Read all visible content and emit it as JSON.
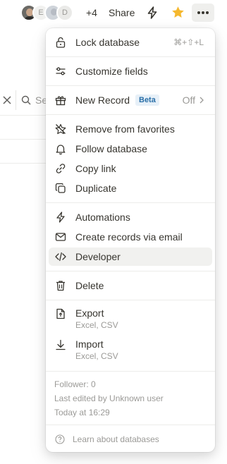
{
  "topbar": {
    "avatars": [
      {
        "letter": ""
      },
      {
        "letter": "E"
      },
      {
        "letter": ""
      },
      {
        "letter": "D"
      }
    ],
    "more_count": "+4",
    "share_label": "Share"
  },
  "background": {
    "search_text": "Se"
  },
  "menu": {
    "lock": {
      "label": "Lock database",
      "shortcut": "⌘+⇧+L"
    },
    "customize": {
      "label": "Customize fields"
    },
    "new_record": {
      "label": "New Record",
      "badge": "Beta",
      "value": "Off"
    },
    "remove_fav": {
      "label": "Remove from favorites"
    },
    "follow": {
      "label": "Follow database"
    },
    "copy_link": {
      "label": "Copy link"
    },
    "duplicate": {
      "label": "Duplicate"
    },
    "automations": {
      "label": "Automations"
    },
    "email_records": {
      "label": "Create records via email"
    },
    "developer": {
      "label": "Developer"
    },
    "delete": {
      "label": "Delete"
    },
    "export": {
      "label": "Export",
      "sub": "Excel, CSV"
    },
    "import": {
      "label": "Import",
      "sub": "Excel, CSV"
    },
    "info": {
      "followers": "Follower: 0",
      "last_edited": "Last edited by Unknown user",
      "time": "Today at 16:29"
    },
    "learn": {
      "label": "Learn about databases"
    }
  },
  "colors": {
    "star": "#f5b82e",
    "highlight": "#f1f1ef",
    "badge_bg": "#e7f0f8",
    "badge_text": "#2a6fa8"
  }
}
